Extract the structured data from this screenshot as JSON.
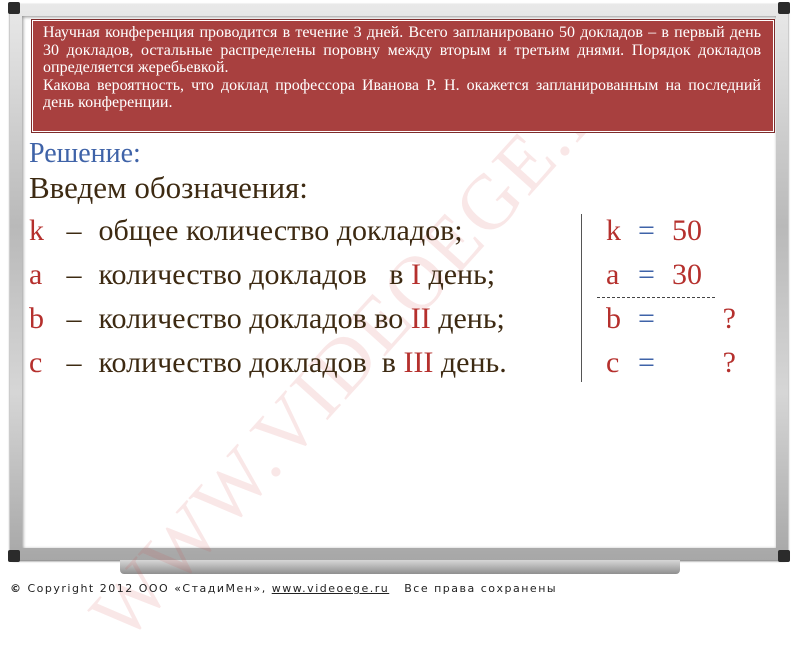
{
  "problem": {
    "paragraph1": "Научная конференция проводится в течение 3 дней. Всего запланировано 50 докладов – в первый день 30 докладов, остальные распределены поровну между вторым и третьим днями. Порядок докладов определяется жеребьевкой.",
    "paragraph2": "Какова вероятность, что доклад профессора Иванова Р. Н. окажется запланированным на последний день конференции."
  },
  "watermark": "WWW.VIDEOEGE.RU",
  "solution": {
    "title": "Решение:",
    "intro": "Введем обозначения:",
    "definitions": [
      {
        "var": "k",
        "dash": "–",
        "text_before": "общее количество докладов;",
        "roman": "",
        "text_after": ""
      },
      {
        "var": "a",
        "dash": "–",
        "text_before": "количество докладов   в ",
        "roman": "I",
        "text_after": " день;"
      },
      {
        "var": "b",
        "dash": "–",
        "text_before": "количество докладов во ",
        "roman": "II",
        "text_after": " день;"
      },
      {
        "var": "c",
        "dash": "–",
        "text_before": "количество докладов  в ",
        "roman": "III",
        "text_after": " день."
      }
    ],
    "values": [
      {
        "var": "k",
        "eq": "=",
        "value": "50"
      },
      {
        "var": "a",
        "eq": "=",
        "value": "30"
      },
      {
        "var": "b",
        "eq": "=",
        "value": "?"
      },
      {
        "var": "c",
        "eq": "=",
        "value": "?"
      }
    ]
  },
  "footer": {
    "copyright_symbol": "©",
    "copyright_text": " Copyright 2012 ООО «СтадиМен», ",
    "link": "www.videoege.ru",
    "rights": "   Все права сохранены"
  },
  "colors": {
    "problem_bg": "#a8403f",
    "variable": "#b5302d",
    "title_blue": "#3f63a8",
    "text_brown": "#3d2a12"
  }
}
